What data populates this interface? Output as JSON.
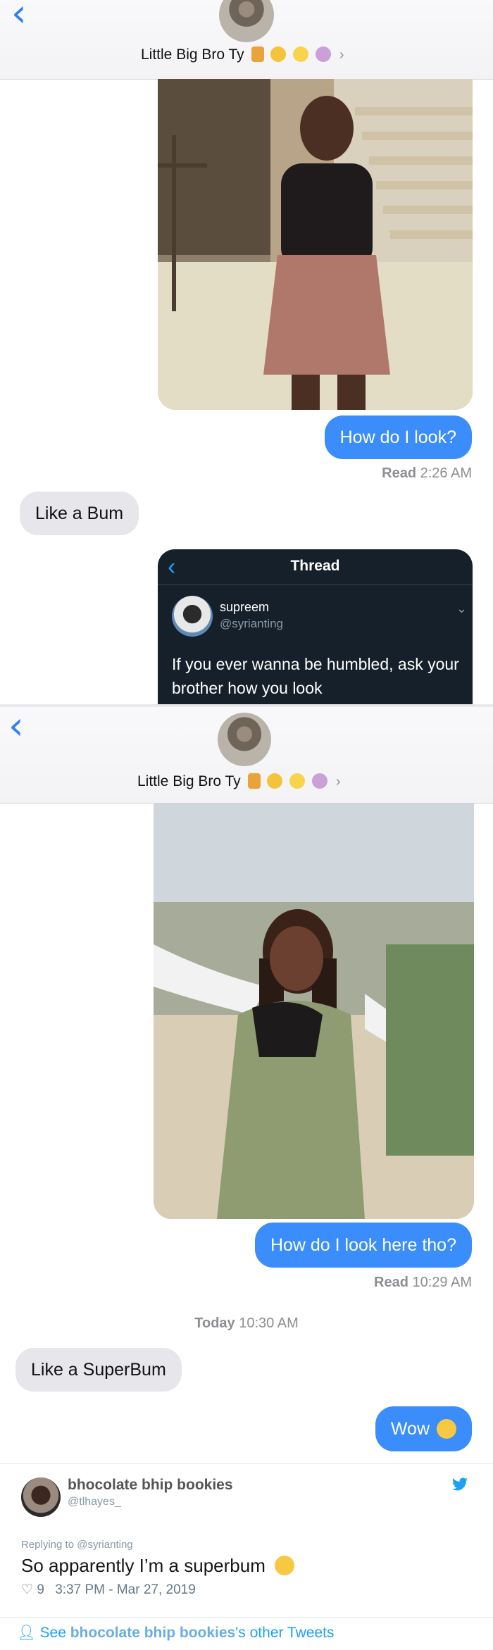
{
  "screen1": {
    "contact_name": "Little Big Bro Ty",
    "message_out": "How do I look?",
    "receipt_label": "Read",
    "receipt_time": "2:26 AM",
    "message_in": "Like a Bum",
    "thread": {
      "title": "Thread",
      "display_name": "supreem",
      "handle": "@syrianting",
      "text": "If you ever wanna be humbled, ask your brother how you look"
    }
  },
  "screen2": {
    "contact_name": "Little Big Bro Ty",
    "message_out": "How do I look here tho?",
    "receipt_label": "Read",
    "receipt_time": "10:29 AM",
    "day_label": "Today",
    "day_time": "10:30 AM",
    "message_in": "Like a SuperBum",
    "message_out2": "Wow"
  },
  "tweet": {
    "display_name": "bhocolate bhip bookies",
    "handle": "@tlhayes_",
    "replying_to": "Replying to @syrianting",
    "text": "So apparently I’m a superbum",
    "likes": "9",
    "timestamp": "3:37 PM - Mar 27, 2019",
    "footer_prefix": "See ",
    "footer_name": "bhocolate bhip bookies",
    "footer_suffix": "'s other Tweets"
  },
  "colors": {
    "imessage_blue": "#3a8dfa",
    "incoming_gray": "#e6e6eb",
    "twitter_blue": "#1da1f2",
    "thread_dark": "#15202b"
  },
  "icons": [
    "back-chevron-icon",
    "chevron-right-icon",
    "heart-icon",
    "twitter-bird-icon",
    "person-icon",
    "emoji-icon"
  ]
}
